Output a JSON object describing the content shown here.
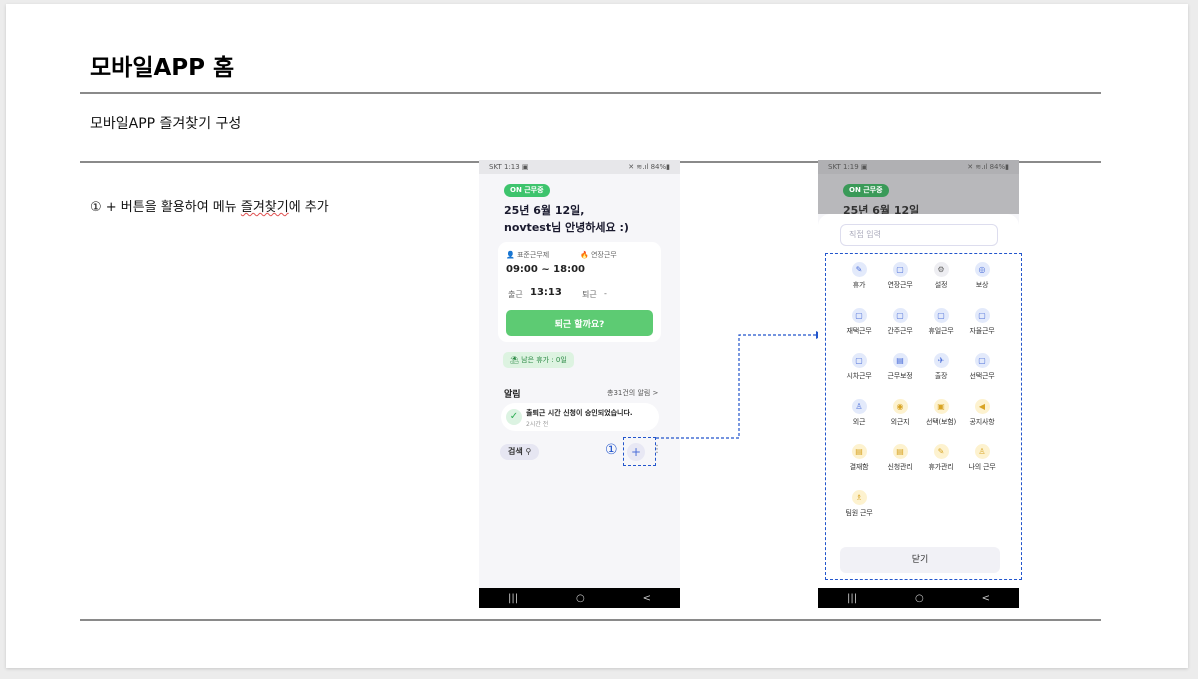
{
  "doc": {
    "title": "모바일APP 홈",
    "subtitle": "모바일APP 즐겨찾기 구성",
    "step_prefix": "① + 버튼을 활용하여 메뉴 ",
    "step_squig": "즐겨찾기",
    "step_suffix": "에 추가",
    "marker": "①"
  },
  "phone1": {
    "status_left": "SKT 1:13 ▣",
    "status_right": "✕ ≋.ıl 84%▮",
    "badge": "ON  근무중",
    "greeting_line1": "25년 6월 12일,",
    "greeting_line2": "novtest님 안녕하세요 :)",
    "work_type_label": "표준근무제",
    "overtime_label": "연장근무",
    "work_hours": "09:00 ~ 18:00",
    "overtime_value": "-",
    "checkin_label": "출근",
    "checkin_time": "13:13",
    "checkout_label": "퇴근",
    "checkout_value": "-",
    "leave_button": "퇴근 할까요?",
    "remaining_leave": "남은 휴가 : 0일",
    "alarm_title": "알림",
    "alarm_more": "총31건의 알림 >",
    "alarm_message": "출퇴근 시간 신청이 승인되었습니다.",
    "alarm_time": "2시간 전",
    "search_label": "검색",
    "plus": "+",
    "kebab": "⋮"
  },
  "phone2": {
    "status_left": "SKT 1:19 ▣",
    "status_right": "✕ ≋.ıl 84%▮",
    "badge": "ON  근무중",
    "greeting_line1": "25년 6월 12일",
    "direct_input_placeholder": "직접 입력",
    "menu_items": [
      {
        "label": "휴가",
        "icon": "umbrella-icon",
        "glyph": "✎",
        "tone": "blue"
      },
      {
        "label": "연장근무",
        "icon": "briefcase-icon",
        "glyph": "▢",
        "tone": "blue"
      },
      {
        "label": "설정",
        "icon": "gear-icon",
        "glyph": "⚙",
        "tone": "gray"
      },
      {
        "label": "보상",
        "icon": "reward-icon",
        "glyph": "◎",
        "tone": "blue"
      },
      {
        "label": "재택근무",
        "icon": "briefcase-icon",
        "glyph": "▢",
        "tone": "blue"
      },
      {
        "label": "간주근무",
        "icon": "briefcase-icon",
        "glyph": "▢",
        "tone": "blue"
      },
      {
        "label": "휴일근무",
        "icon": "briefcase-icon",
        "glyph": "▢",
        "tone": "blue"
      },
      {
        "label": "자율근무",
        "icon": "briefcase-icon",
        "glyph": "▢",
        "tone": "blue"
      },
      {
        "label": "시차근무",
        "icon": "briefcase-icon",
        "glyph": "▢",
        "tone": "blue"
      },
      {
        "label": "근무보정",
        "icon": "calendar-icon",
        "glyph": "▤",
        "tone": "blue"
      },
      {
        "label": "출장",
        "icon": "airplane-icon",
        "glyph": "✈",
        "tone": "blue"
      },
      {
        "label": "선택근무",
        "icon": "briefcase-icon",
        "glyph": "▢",
        "tone": "blue"
      },
      {
        "label": "외근",
        "icon": "walking-icon",
        "glyph": "♙",
        "tone": "blue"
      },
      {
        "label": "외근지",
        "icon": "location-icon",
        "glyph": "◉",
        "tone": "yellow"
      },
      {
        "label": "선택(보험)",
        "icon": "document-icon",
        "glyph": "▣",
        "tone": "yellow"
      },
      {
        "label": "공지사항",
        "icon": "megaphone-icon",
        "glyph": "◀",
        "tone": "yellow"
      },
      {
        "label": "결재함",
        "icon": "inbox-icon",
        "glyph": "▤",
        "tone": "yellow"
      },
      {
        "label": "신청관리",
        "icon": "list-icon",
        "glyph": "▤",
        "tone": "yellow"
      },
      {
        "label": "휴가관리",
        "icon": "umbrella-icon",
        "glyph": "✎",
        "tone": "yellow"
      },
      {
        "label": "나의 근무",
        "icon": "person-icon",
        "glyph": "♙",
        "tone": "yellow"
      },
      {
        "label": "팀원 근무",
        "icon": "team-icon",
        "glyph": "♗",
        "tone": "yellow"
      }
    ],
    "close_button": "닫기"
  },
  "nav": {
    "recent": "|||",
    "home": "○",
    "back": "<"
  },
  "colors": {
    "accent_blue": "#2255cc",
    "green": "#5dcb73",
    "rule": "#8a8a8a"
  }
}
